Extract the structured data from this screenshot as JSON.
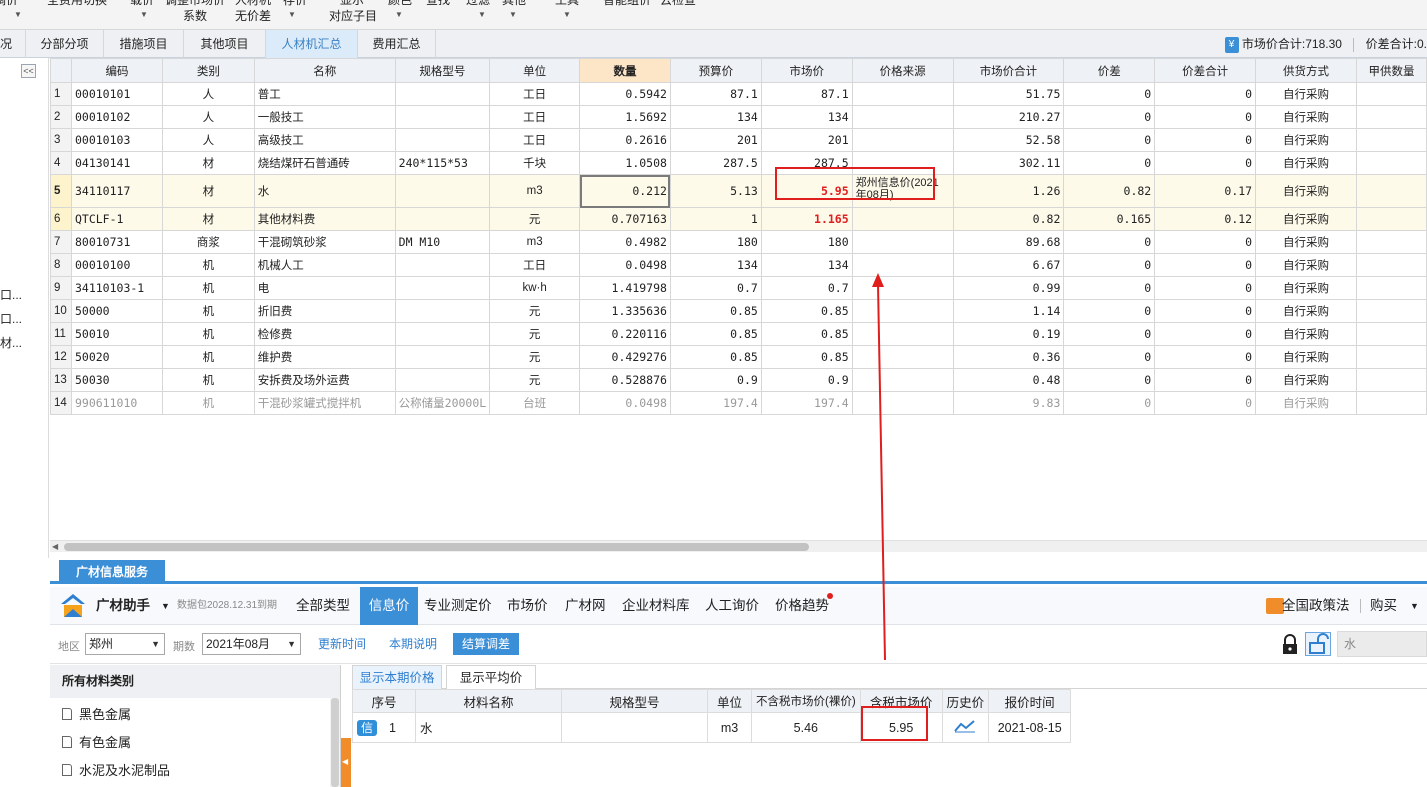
{
  "toolbar": {
    "items": [
      {
        "label": "调价",
        "name": "tb-adjust"
      },
      {
        "label": "全费用切换",
        "name": "tb-full-cost-toggle"
      },
      {
        "label": "载价",
        "name": "tb-load-price"
      },
      {
        "label": "调整市场价",
        "name": "tb-adjust-market-price"
      },
      {
        "label": "人材机",
        "name": "tb-labor-material-machine"
      },
      {
        "label": "存价",
        "name": "tb-save-price"
      },
      {
        "label": "显示",
        "name": "tb-display"
      },
      {
        "label": "颜色",
        "name": "tb-color"
      },
      {
        "label": "查找",
        "name": "tb-find"
      },
      {
        "label": "过滤",
        "name": "tb-filter"
      },
      {
        "label": "其他",
        "name": "tb-other"
      },
      {
        "label": "工具",
        "name": "tb-tools"
      },
      {
        "label": "智能组价",
        "name": "tb-smart-pricing"
      },
      {
        "label": "云检查",
        "name": "tb-cloud-check"
      }
    ],
    "sublabels": {
      "coefficient": "系数",
      "no_diff": "无价差",
      "sub_item": "对应子目"
    }
  },
  "tabs": [
    {
      "label": "况",
      "name": "tab-overview"
    },
    {
      "label": "分部分项",
      "name": "tab-sections"
    },
    {
      "label": "措施项目",
      "name": "tab-measures"
    },
    {
      "label": "其他项目",
      "name": "tab-other-items"
    },
    {
      "label": "人材机汇总",
      "name": "tab-lmm-summary"
    },
    {
      "label": "费用汇总",
      "name": "tab-cost-summary"
    }
  ],
  "summary": {
    "market_total_label": "市场价合计:718.30",
    "diff_total_label": "价差合计:0."
  },
  "left_panel": {
    "collapse": "<<",
    "truncated": [
      "口...",
      "口...",
      "材..."
    ]
  },
  "grid": {
    "columns": [
      "编码",
      "类别",
      "名称",
      "规格型号",
      "单位",
      "数量",
      "预算价",
      "市场价",
      "价格来源",
      "市场价合计",
      "价差",
      "价差合计",
      "供货方式",
      "甲供数量"
    ],
    "rows": [
      {
        "n": "1",
        "code": "00010101",
        "type": "人",
        "name": "普工",
        "spec": "",
        "unit": "工日",
        "qty": "0.5942",
        "budget": "87.1",
        "market": "87.1",
        "source": "",
        "total": "51.75",
        "diff": "0",
        "diff_total": "0",
        "supply": "自行采购"
      },
      {
        "n": "2",
        "code": "00010102",
        "type": "人",
        "name": "一般技工",
        "spec": "",
        "unit": "工日",
        "qty": "1.5692",
        "budget": "134",
        "market": "134",
        "source": "",
        "total": "210.27",
        "diff": "0",
        "diff_total": "0",
        "supply": "自行采购"
      },
      {
        "n": "3",
        "code": "00010103",
        "type": "人",
        "name": "高级技工",
        "spec": "",
        "unit": "工日",
        "qty": "0.2616",
        "budget": "201",
        "market": "201",
        "source": "",
        "total": "52.58",
        "diff": "0",
        "diff_total": "0",
        "supply": "自行采购"
      },
      {
        "n": "4",
        "code": "04130141",
        "type": "材",
        "name": "烧结煤矸石普通砖",
        "spec": "240*115*53",
        "unit": "千块",
        "qty": "1.0508",
        "budget": "287.5",
        "market": "287.5",
        "source": "",
        "total": "302.11",
        "diff": "0",
        "diff_total": "0",
        "supply": "自行采购"
      },
      {
        "n": "5",
        "code": "34110117",
        "type": "材",
        "name": "水",
        "spec": "",
        "unit": "m3",
        "qty": "0.212",
        "budget": "5.13",
        "market": "5.95",
        "source": "郑州信息价(2021年08月)",
        "total": "1.26",
        "diff": "0.82",
        "diff_total": "0.17",
        "supply": "自行采购"
      },
      {
        "n": "6",
        "code": "QTCLF-1",
        "type": "材",
        "name": "其他材料费",
        "spec": "",
        "unit": "元",
        "qty": "0.707163",
        "budget": "1",
        "market": "1.165",
        "source": "",
        "total": "0.82",
        "diff": "0.165",
        "diff_total": "0.12",
        "supply": "自行采购"
      },
      {
        "n": "7",
        "code": "80010731",
        "type": "商浆",
        "name": "干混砌筑砂浆",
        "spec": "DM M10",
        "unit": "m3",
        "qty": "0.4982",
        "budget": "180",
        "market": "180",
        "source": "",
        "total": "89.68",
        "diff": "0",
        "diff_total": "0",
        "supply": "自行采购"
      },
      {
        "n": "8",
        "code": "00010100",
        "type": "机",
        "name": "机械人工",
        "spec": "",
        "unit": "工日",
        "qty": "0.0498",
        "budget": "134",
        "market": "134",
        "source": "",
        "total": "6.67",
        "diff": "0",
        "diff_total": "0",
        "supply": "自行采购"
      },
      {
        "n": "9",
        "code": "34110103-1",
        "type": "机",
        "name": "电",
        "spec": "",
        "unit": "kw·h",
        "qty": "1.419798",
        "budget": "0.7",
        "market": "0.7",
        "source": "",
        "total": "0.99",
        "diff": "0",
        "diff_total": "0",
        "supply": "自行采购"
      },
      {
        "n": "10",
        "code": "50000",
        "type": "机",
        "name": "折旧费",
        "spec": "",
        "unit": "元",
        "qty": "1.335636",
        "budget": "0.85",
        "market": "0.85",
        "source": "",
        "total": "1.14",
        "diff": "0",
        "diff_total": "0",
        "supply": "自行采购"
      },
      {
        "n": "11",
        "code": "50010",
        "type": "机",
        "name": "检修费",
        "spec": "",
        "unit": "元",
        "qty": "0.220116",
        "budget": "0.85",
        "market": "0.85",
        "source": "",
        "total": "0.19",
        "diff": "0",
        "diff_total": "0",
        "supply": "自行采购"
      },
      {
        "n": "12",
        "code": "50020",
        "type": "机",
        "name": "维护费",
        "spec": "",
        "unit": "元",
        "qty": "0.429276",
        "budget": "0.85",
        "market": "0.85",
        "source": "",
        "total": "0.36",
        "diff": "0",
        "diff_total": "0",
        "supply": "自行采购"
      },
      {
        "n": "13",
        "code": "50030",
        "type": "机",
        "name": "安拆费及场外运费",
        "spec": "",
        "unit": "元",
        "qty": "0.528876",
        "budget": "0.9",
        "market": "0.9",
        "source": "",
        "total": "0.48",
        "diff": "0",
        "diff_total": "0",
        "supply": "自行采购"
      },
      {
        "n": "14",
        "code": "990611010",
        "type": "机",
        "name": "干混砂浆罐式搅拌机",
        "spec": "公称储量20000L",
        "unit": "台班",
        "qty": "0.0498",
        "budget": "197.4",
        "market": "197.4",
        "source": "",
        "total": "9.83",
        "diff": "0",
        "diff_total": "0",
        "supply": "自行采购"
      }
    ]
  },
  "service": {
    "tab_label": "广材信息服务",
    "assistant_name": "广材助手",
    "data_pack_note": "数据包2028.12.31到期",
    "nav": [
      {
        "label": "全部类型",
        "name": "nav-all-types"
      },
      {
        "label": "信息价",
        "name": "nav-info-price"
      },
      {
        "label": "专业测定价",
        "name": "nav-professional-price"
      },
      {
        "label": "市场价",
        "name": "nav-market-price"
      },
      {
        "label": "广材网",
        "name": "nav-gcw"
      },
      {
        "label": "企业材料库",
        "name": "nav-enterprise-library"
      },
      {
        "label": "人工询价",
        "name": "nav-manual-inquiry"
      },
      {
        "label": "价格趋势",
        "name": "nav-price-trend"
      }
    ],
    "policy_label": "全国政策法",
    "buy_label": "购买"
  },
  "filters": {
    "region_label": "地区",
    "region_value": "郑州",
    "period_label": "期数",
    "period_value": "2021年08月",
    "update_time": "更新时间",
    "period_note": "本期说明",
    "settle_adjust": "结算调差",
    "search_value": "水"
  },
  "categories": {
    "header": "所有材料类别",
    "items": [
      "黑色金属",
      "有色金属",
      "水泥及水泥制品"
    ]
  },
  "price_tabs": [
    "显示本期价格",
    "显示平均价"
  ],
  "info_table": {
    "columns": [
      "序号",
      "材料名称",
      "规格型号",
      "单位",
      "不含税市场价(裸价)",
      "含税市场价",
      "历史价",
      "报价时间"
    ],
    "rows": [
      {
        "badge": "信",
        "n": "1",
        "name": "水",
        "spec": "",
        "unit": "m3",
        "excl_tax": "5.46",
        "incl_tax": "5.95",
        "history": "trend-icon",
        "time": "2021-08-15"
      }
    ]
  },
  "colors": {
    "accent_blue": "#3b8fd7",
    "highlight_red": "#e01e1e",
    "qty_header": "#fde5c8",
    "selected_row": "#fdfaea",
    "side_handle": "#f08c2a"
  }
}
